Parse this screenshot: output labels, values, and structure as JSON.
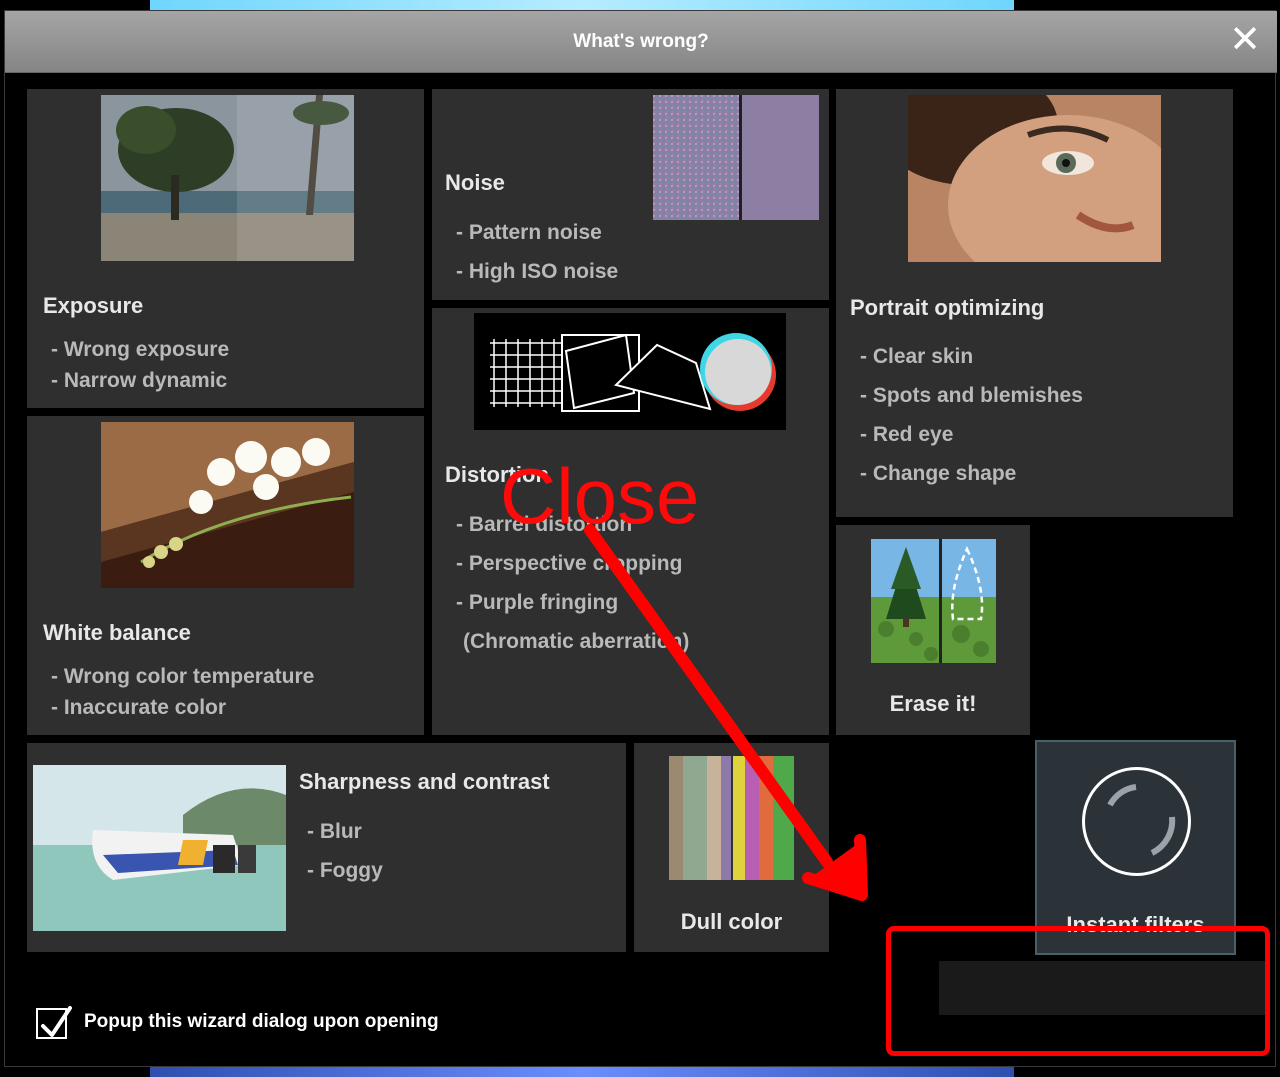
{
  "dialog": {
    "title": "What's wrong?",
    "close_glyph": "✕"
  },
  "tiles": {
    "exposure": {
      "heading": "Exposure",
      "items": [
        "- Wrong exposure",
        "- Narrow dynamic"
      ]
    },
    "noise": {
      "heading": "Noise",
      "items": [
        "- Pattern noise",
        "- High ISO noise"
      ]
    },
    "portrait": {
      "heading": "Portrait optimizing",
      "items": [
        "- Clear skin",
        "- Spots and blemishes",
        "- Red eye",
        "- Change shape"
      ]
    },
    "white_balance": {
      "heading": "White balance",
      "items": [
        "- Wrong color temperature",
        "- Inaccurate color"
      ]
    },
    "distortion": {
      "heading": "Distortion",
      "items": [
        "- Barrel distortion",
        "- Perspective cropping",
        "- Purple fringing",
        "(Chromatic aberration)"
      ]
    },
    "erase": {
      "heading": "Erase it!"
    },
    "sharpness": {
      "heading": "Sharpness and contrast",
      "items": [
        "- Blur",
        "- Foggy"
      ]
    },
    "dull_color": {
      "heading": "Dull color"
    },
    "instant_filters": {
      "heading": "Instant filters"
    }
  },
  "footer": {
    "checkbox_label": "Popup this wizard dialog upon opening",
    "checkbox_checked": true
  },
  "annotation": {
    "text": "Close",
    "color": "#ff0000"
  },
  "icons": {
    "close": "close-icon",
    "check": "checkmark-icon",
    "instant_filters": "circle-spinner-icon"
  }
}
